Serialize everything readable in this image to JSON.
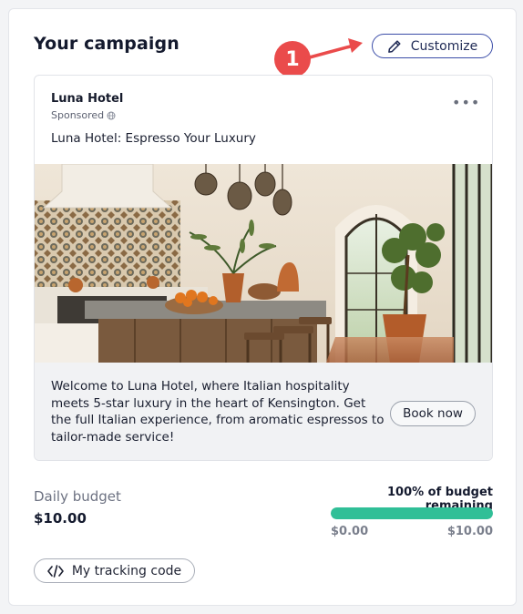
{
  "campaign": {
    "title": "Your campaign",
    "customize_label": "Customize",
    "annotation_number": "1"
  },
  "ad": {
    "name": "Luna Hotel",
    "sponsored": "Sponsored",
    "more_glyph": "•••",
    "headline": "Luna Hotel: Espresso Your Luxury",
    "description": "Welcome to Luna Hotel, where Italian hospitality meets 5-star luxury in the heart of Kensington. Get the full Italian experience, from aromatic espressos to tailor-made service!",
    "cta_label": "Book now"
  },
  "budget": {
    "label": "Daily budget",
    "value": "$10.00",
    "remaining_label": "100% of budget remaining",
    "remaining_fraction": 1.0,
    "min_label": "$0.00",
    "max_label": "$10.00"
  },
  "tracking": {
    "label": "My tracking code"
  },
  "colors": {
    "accent_blue": "#3b4da8",
    "progress_green": "#30bf97",
    "annotation_red": "#ea4b4b"
  },
  "icons": [
    "pencil-icon",
    "globe-icon",
    "more-icon",
    "code-icon",
    "annotation-arrow"
  ]
}
